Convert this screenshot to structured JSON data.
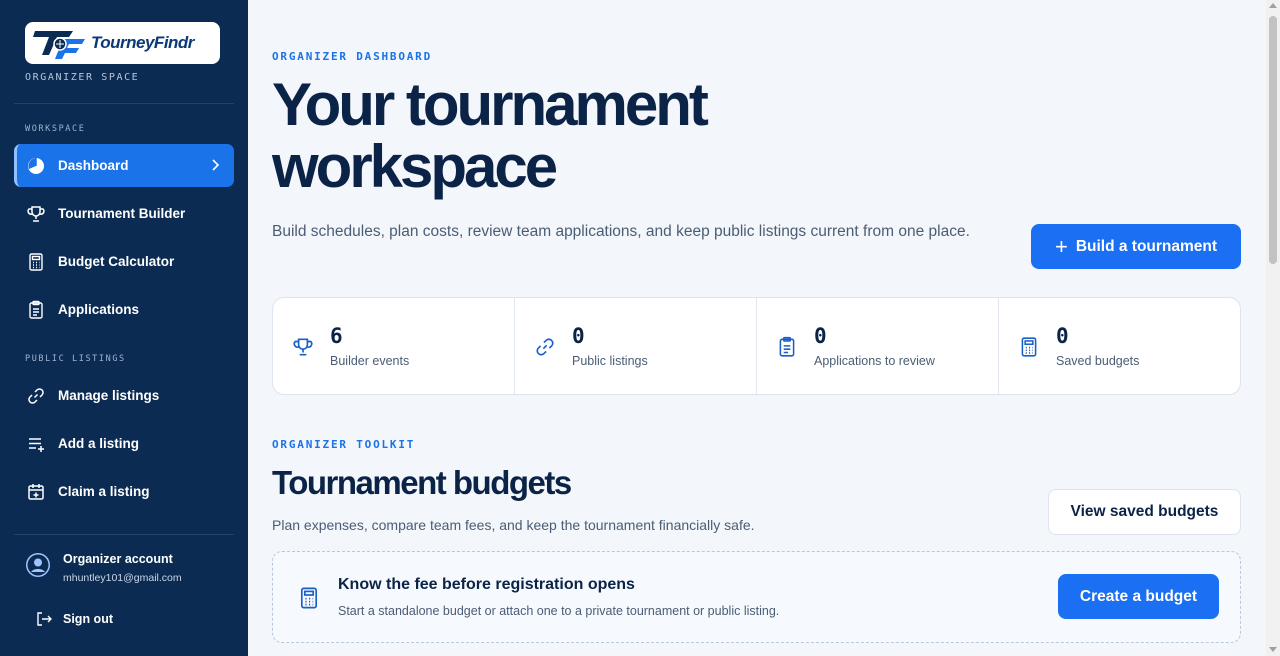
{
  "brand": {
    "name": "TourneyFindr",
    "space_label": "ORGANIZER SPACE"
  },
  "sidebar": {
    "workspace_label": "WORKSPACE",
    "workspace_items": [
      {
        "label": "Dashboard",
        "icon": "pie-chart-icon",
        "active": true
      },
      {
        "label": "Tournament Builder",
        "icon": "trophy-icon"
      },
      {
        "label": "Budget Calculator",
        "icon": "calculator-icon"
      },
      {
        "label": "Applications",
        "icon": "clipboard-icon"
      }
    ],
    "public_label": "PUBLIC LISTINGS",
    "public_items": [
      {
        "label": "Manage listings",
        "icon": "link-icon"
      },
      {
        "label": "Add a listing",
        "icon": "list-add-icon"
      },
      {
        "label": "Claim a listing",
        "icon": "calendar-plus-icon"
      }
    ],
    "account": {
      "name": "Organizer account",
      "email": "mhuntley101@gmail.com"
    },
    "sign_out": "Sign out"
  },
  "hero": {
    "eyebrow": "ORGANIZER DASHBOARD",
    "title": "Your tournament workspace",
    "description": "Build schedules, plan costs, review team applications, and keep public listings current from one place.",
    "button": "Build a tournament"
  },
  "stats": [
    {
      "value": "6",
      "label": "Builder events",
      "icon": "trophy-icon"
    },
    {
      "value": "0",
      "label": "Public listings",
      "icon": "link-icon"
    },
    {
      "value": "0",
      "label": "Applications to review",
      "icon": "clipboard-icon"
    },
    {
      "value": "0",
      "label": "Saved budgets",
      "icon": "calculator-icon"
    }
  ],
  "toolkit": {
    "eyebrow": "ORGANIZER TOOLKIT",
    "title": "Tournament budgets",
    "description": "Plan expenses, compare team fees, and keep the tournament financially safe.",
    "secondary_button": "View saved budgets",
    "callout": {
      "title": "Know the fee before registration opens",
      "description": "Start a standalone budget or attach one to a private tournament or public listing.",
      "button": "Create a budget"
    }
  },
  "colors": {
    "sidebar": "#0b2b52",
    "accent": "#1a73e8",
    "title": "#0b2347",
    "background": "#f3f6fa"
  }
}
